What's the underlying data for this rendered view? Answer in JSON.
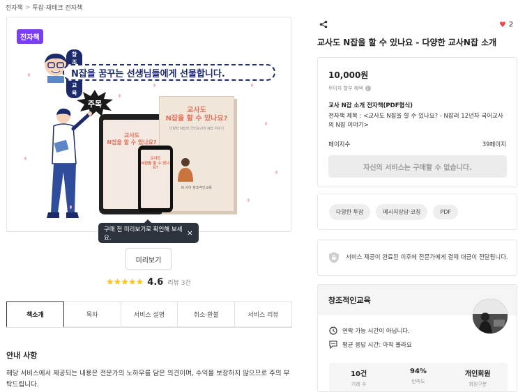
{
  "breadcrumb": {
    "items": [
      "전자책",
      "투잡·재테크 전자책"
    ],
    "separator": ">"
  },
  "product_image": {
    "badge": "전자책",
    "banner_tag": "창조적인 교육",
    "banner_text": "N잡을 꿈꾸는 선생님들에게 선물합니다.",
    "starburst_text": "주목",
    "book_title": "교사도\nN잡을 할 수 있나요?",
    "book_subtitle": "다양한 N잡러 국어교사의 N잡 이야기",
    "book_author": "N 사이 창조적인교육",
    "tablet_title": "교사도\nN잡을 할 수 있나요?",
    "phone_title": "교사도\nN잡을 할 수 있나요?"
  },
  "tooltip": {
    "text": "구매 전 미리보기로 확인해 보세요.",
    "close": "×"
  },
  "preview_button": "미리보기",
  "rating": {
    "stars": "★★★★★",
    "value": "4.6",
    "reviews": "리뷰 3건"
  },
  "tabs": [
    "책소개",
    "목차",
    "서비스 설명",
    "취소·환불",
    "서비스 리뷰"
  ],
  "active_tab": 0,
  "notice": {
    "title": "안내 사항",
    "body": "해당 서비스에서 제공되는 내용은 전문가의 노하우를 담은 의견이며, 수익을 보장하지 않으므로 주의 부탁드립니다."
  },
  "like": {
    "count": "2"
  },
  "product_title": "교사도 N잡을 할 수 있나요 - 다양한 교사N잡 소개",
  "purchase": {
    "price": "10,000원",
    "installment": "무이자 할부 혜택",
    "info_symbol": "i",
    "package_title": "교사 N잡 소개 전자책(PDF형식)",
    "package_desc": "전자책 제목 : <교사도 N잡을 할 수 있나요? - N잡러 12년차 국어교사의 N잡 이야기>",
    "pages_label": "페이지수",
    "pages_value": "39페이지",
    "buy_button": "자신의 서비스는 구매할 수 없습니다."
  },
  "tags": [
    "다양한 투잡",
    "메시지상담·코칭",
    "PDF"
  ],
  "secure_notice": "서비스 제공이 완료된 이후에 전문가에게 결제 대금이 전달됩니다.",
  "seller": {
    "name": "창조적인교육",
    "contact": "연락 가능 시간이 아닙니다.",
    "response": "평균 응답 시간: 아직 몰라요",
    "stats": [
      {
        "value": "10건",
        "label": "거래 수"
      },
      {
        "value": "94%",
        "label": "만족도"
      },
      {
        "value": "개인회원",
        "label": "회원구분"
      }
    ]
  },
  "colors": {
    "badge_purple": "#7b3ff2",
    "banner_navy": "#1c2a6c",
    "star_yellow": "#ffc21a",
    "heart_red": "#e64a4a",
    "book_title_red": "#e2705c"
  }
}
